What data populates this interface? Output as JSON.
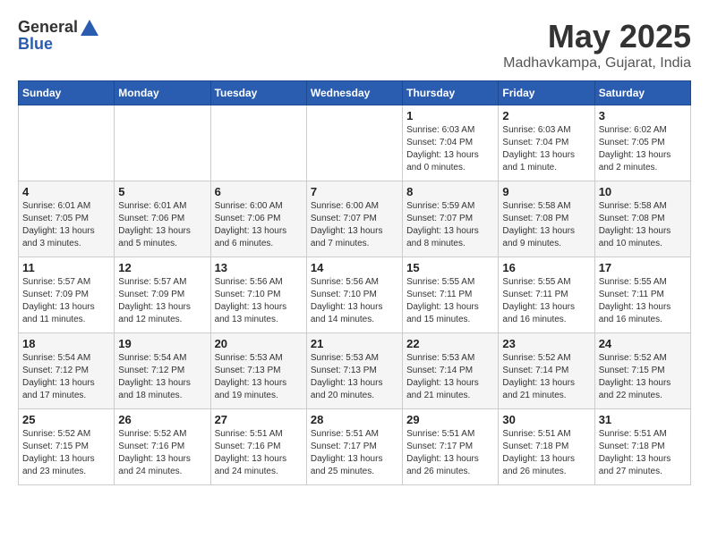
{
  "logo": {
    "general": "General",
    "blue": "Blue"
  },
  "title": "May 2025",
  "location": "Madhavkampa, Gujarat, India",
  "days_of_week": [
    "Sunday",
    "Monday",
    "Tuesday",
    "Wednesday",
    "Thursday",
    "Friday",
    "Saturday"
  ],
  "weeks": [
    [
      {
        "day": "",
        "info": ""
      },
      {
        "day": "",
        "info": ""
      },
      {
        "day": "",
        "info": ""
      },
      {
        "day": "",
        "info": ""
      },
      {
        "day": "1",
        "info": "Sunrise: 6:03 AM\nSunset: 7:04 PM\nDaylight: 13 hours\nand 0 minutes."
      },
      {
        "day": "2",
        "info": "Sunrise: 6:03 AM\nSunset: 7:04 PM\nDaylight: 13 hours\nand 1 minute."
      },
      {
        "day": "3",
        "info": "Sunrise: 6:02 AM\nSunset: 7:05 PM\nDaylight: 13 hours\nand 2 minutes."
      }
    ],
    [
      {
        "day": "4",
        "info": "Sunrise: 6:01 AM\nSunset: 7:05 PM\nDaylight: 13 hours\nand 3 minutes."
      },
      {
        "day": "5",
        "info": "Sunrise: 6:01 AM\nSunset: 7:06 PM\nDaylight: 13 hours\nand 5 minutes."
      },
      {
        "day": "6",
        "info": "Sunrise: 6:00 AM\nSunset: 7:06 PM\nDaylight: 13 hours\nand 6 minutes."
      },
      {
        "day": "7",
        "info": "Sunrise: 6:00 AM\nSunset: 7:07 PM\nDaylight: 13 hours\nand 7 minutes."
      },
      {
        "day": "8",
        "info": "Sunrise: 5:59 AM\nSunset: 7:07 PM\nDaylight: 13 hours\nand 8 minutes."
      },
      {
        "day": "9",
        "info": "Sunrise: 5:58 AM\nSunset: 7:08 PM\nDaylight: 13 hours\nand 9 minutes."
      },
      {
        "day": "10",
        "info": "Sunrise: 5:58 AM\nSunset: 7:08 PM\nDaylight: 13 hours\nand 10 minutes."
      }
    ],
    [
      {
        "day": "11",
        "info": "Sunrise: 5:57 AM\nSunset: 7:09 PM\nDaylight: 13 hours\nand 11 minutes."
      },
      {
        "day": "12",
        "info": "Sunrise: 5:57 AM\nSunset: 7:09 PM\nDaylight: 13 hours\nand 12 minutes."
      },
      {
        "day": "13",
        "info": "Sunrise: 5:56 AM\nSunset: 7:10 PM\nDaylight: 13 hours\nand 13 minutes."
      },
      {
        "day": "14",
        "info": "Sunrise: 5:56 AM\nSunset: 7:10 PM\nDaylight: 13 hours\nand 14 minutes."
      },
      {
        "day": "15",
        "info": "Sunrise: 5:55 AM\nSunset: 7:11 PM\nDaylight: 13 hours\nand 15 minutes."
      },
      {
        "day": "16",
        "info": "Sunrise: 5:55 AM\nSunset: 7:11 PM\nDaylight: 13 hours\nand 16 minutes."
      },
      {
        "day": "17",
        "info": "Sunrise: 5:55 AM\nSunset: 7:11 PM\nDaylight: 13 hours\nand 16 minutes."
      }
    ],
    [
      {
        "day": "18",
        "info": "Sunrise: 5:54 AM\nSunset: 7:12 PM\nDaylight: 13 hours\nand 17 minutes."
      },
      {
        "day": "19",
        "info": "Sunrise: 5:54 AM\nSunset: 7:12 PM\nDaylight: 13 hours\nand 18 minutes."
      },
      {
        "day": "20",
        "info": "Sunrise: 5:53 AM\nSunset: 7:13 PM\nDaylight: 13 hours\nand 19 minutes."
      },
      {
        "day": "21",
        "info": "Sunrise: 5:53 AM\nSunset: 7:13 PM\nDaylight: 13 hours\nand 20 minutes."
      },
      {
        "day": "22",
        "info": "Sunrise: 5:53 AM\nSunset: 7:14 PM\nDaylight: 13 hours\nand 21 minutes."
      },
      {
        "day": "23",
        "info": "Sunrise: 5:52 AM\nSunset: 7:14 PM\nDaylight: 13 hours\nand 21 minutes."
      },
      {
        "day": "24",
        "info": "Sunrise: 5:52 AM\nSunset: 7:15 PM\nDaylight: 13 hours\nand 22 minutes."
      }
    ],
    [
      {
        "day": "25",
        "info": "Sunrise: 5:52 AM\nSunset: 7:15 PM\nDaylight: 13 hours\nand 23 minutes."
      },
      {
        "day": "26",
        "info": "Sunrise: 5:52 AM\nSunset: 7:16 PM\nDaylight: 13 hours\nand 24 minutes."
      },
      {
        "day": "27",
        "info": "Sunrise: 5:51 AM\nSunset: 7:16 PM\nDaylight: 13 hours\nand 24 minutes."
      },
      {
        "day": "28",
        "info": "Sunrise: 5:51 AM\nSunset: 7:17 PM\nDaylight: 13 hours\nand 25 minutes."
      },
      {
        "day": "29",
        "info": "Sunrise: 5:51 AM\nSunset: 7:17 PM\nDaylight: 13 hours\nand 26 minutes."
      },
      {
        "day": "30",
        "info": "Sunrise: 5:51 AM\nSunset: 7:18 PM\nDaylight: 13 hours\nand 26 minutes."
      },
      {
        "day": "31",
        "info": "Sunrise: 5:51 AM\nSunset: 7:18 PM\nDaylight: 13 hours\nand 27 minutes."
      }
    ]
  ]
}
